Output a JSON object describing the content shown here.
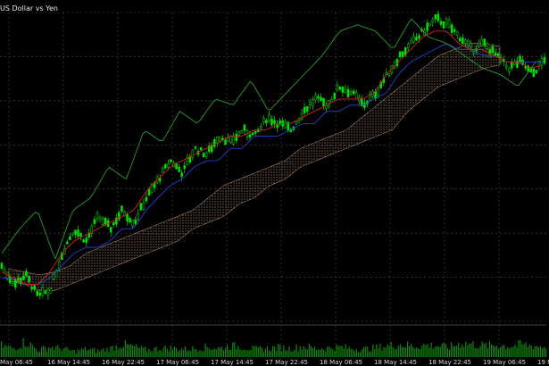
{
  "window": {
    "symbol_title": "US Dollar vs Yen"
  },
  "colors": {
    "background": "#000000",
    "grid": "#4a4a4a",
    "candles": "#00e000",
    "chikou_span": "#2a9a2a",
    "tenkan_sen": "#d02020",
    "kijun_sen": "#2040d0",
    "kumo_cloud": "#a07a60",
    "volume": "#118811",
    "axis_text": "#d8d8d8"
  },
  "chart_data": {
    "type": "line",
    "subtype": "candlestick with Ichimoku Kinko Hyo overlay and volume histogram",
    "title": "US Dollar vs Yen",
    "grid": true,
    "legend": "none",
    "x_tick_labels": [
      "May 06:45",
      "16 May 14:45",
      "16 May 22:45",
      "17 May 06:45",
      "17 May 14:45",
      "17 May 22:45",
      "18 May 06:45",
      "18 May 14:45",
      "18 May 22:45",
      "19 May 06:45",
      "19 M"
    ],
    "price_path": [
      0.18,
      0.12,
      0.15,
      0.08,
      0.1,
      0.22,
      0.3,
      0.26,
      0.34,
      0.3,
      0.36,
      0.32,
      0.4,
      0.46,
      0.52,
      0.48,
      0.56,
      0.54,
      0.6,
      0.58,
      0.62,
      0.6,
      0.66,
      0.64,
      0.62,
      0.68,
      0.72,
      0.7,
      0.76,
      0.74,
      0.7,
      0.74,
      0.8,
      0.86,
      0.9,
      0.94,
      0.98,
      0.96,
      0.92,
      0.88,
      0.9,
      0.86,
      0.82,
      0.84,
      0.8,
      0.85
    ],
    "tenkan_sen": [
      0.16,
      0.14,
      0.12,
      0.12,
      0.16,
      0.22,
      0.26,
      0.28,
      0.3,
      0.32,
      0.34,
      0.36,
      0.42,
      0.46,
      0.5,
      0.52,
      0.54,
      0.56,
      0.58,
      0.6,
      0.6,
      0.62,
      0.62,
      0.64,
      0.64,
      0.66,
      0.68,
      0.7,
      0.72,
      0.72,
      0.72,
      0.74,
      0.8,
      0.84,
      0.88,
      0.92,
      0.94,
      0.94,
      0.9,
      0.88,
      0.88,
      0.86,
      0.84,
      0.84,
      0.82,
      0.83
    ],
    "kijun_sen": [
      0.14,
      0.14,
      0.12,
      0.12,
      0.14,
      0.18,
      0.22,
      0.24,
      0.24,
      0.26,
      0.3,
      0.3,
      0.36,
      0.4,
      0.44,
      0.46,
      0.5,
      0.52,
      0.52,
      0.56,
      0.56,
      0.6,
      0.6,
      0.6,
      0.62,
      0.64,
      0.64,
      0.68,
      0.68,
      0.7,
      0.7,
      0.72,
      0.74,
      0.8,
      0.84,
      0.86,
      0.88,
      0.9,
      0.88,
      0.88,
      0.86,
      0.86,
      0.84,
      0.84,
      0.84,
      0.84
    ],
    "chikou_span": [
      0.22,
      0.3,
      0.36,
      0.2,
      0.36,
      0.4,
      0.5,
      0.46,
      0.62,
      0.58,
      0.68,
      0.64,
      0.72,
      0.7,
      0.78,
      0.68,
      0.74,
      0.8,
      0.86,
      0.94,
      0.96,
      0.94,
      0.88,
      0.98,
      0.92,
      0.9,
      0.86,
      0.82,
      0.8,
      0.76,
      0.84
    ],
    "kumo_upper": [
      0.17,
      0.16,
      0.15,
      0.16,
      0.18,
      0.22,
      0.24,
      0.26,
      0.28,
      0.3,
      0.32,
      0.34,
      0.36,
      0.4,
      0.44,
      0.46,
      0.48,
      0.5,
      0.52,
      0.56,
      0.58,
      0.6,
      0.62,
      0.66,
      0.7,
      0.74,
      0.78,
      0.82,
      0.86,
      0.88,
      0.9,
      0.9,
      0.89
    ],
    "kumo_lower": [
      0.13,
      0.12,
      0.1,
      0.1,
      0.12,
      0.14,
      0.16,
      0.18,
      0.2,
      0.22,
      0.24,
      0.26,
      0.3,
      0.32,
      0.34,
      0.38,
      0.4,
      0.44,
      0.46,
      0.5,
      0.52,
      0.54,
      0.56,
      0.58,
      0.6,
      0.62,
      0.68,
      0.72,
      0.76,
      0.78,
      0.8,
      0.82,
      0.83
    ],
    "volume": [
      0.4,
      0.3,
      0.55,
      0.25,
      0.35,
      0.3,
      0.2,
      0.28,
      0.22,
      0.3,
      0.45,
      0.35,
      0.25,
      0.3,
      0.32,
      0.28,
      0.3,
      0.35,
      0.3,
      0.4,
      0.35,
      0.28,
      0.3,
      0.34,
      0.3,
      0.38,
      0.3,
      0.32,
      0.35,
      0.3,
      0.28,
      0.33,
      0.4,
      0.45,
      0.38,
      0.42,
      0.4,
      0.35,
      0.5,
      0.45,
      0.4,
      0.42,
      0.38,
      0.44,
      0.4,
      0.36
    ]
  }
}
